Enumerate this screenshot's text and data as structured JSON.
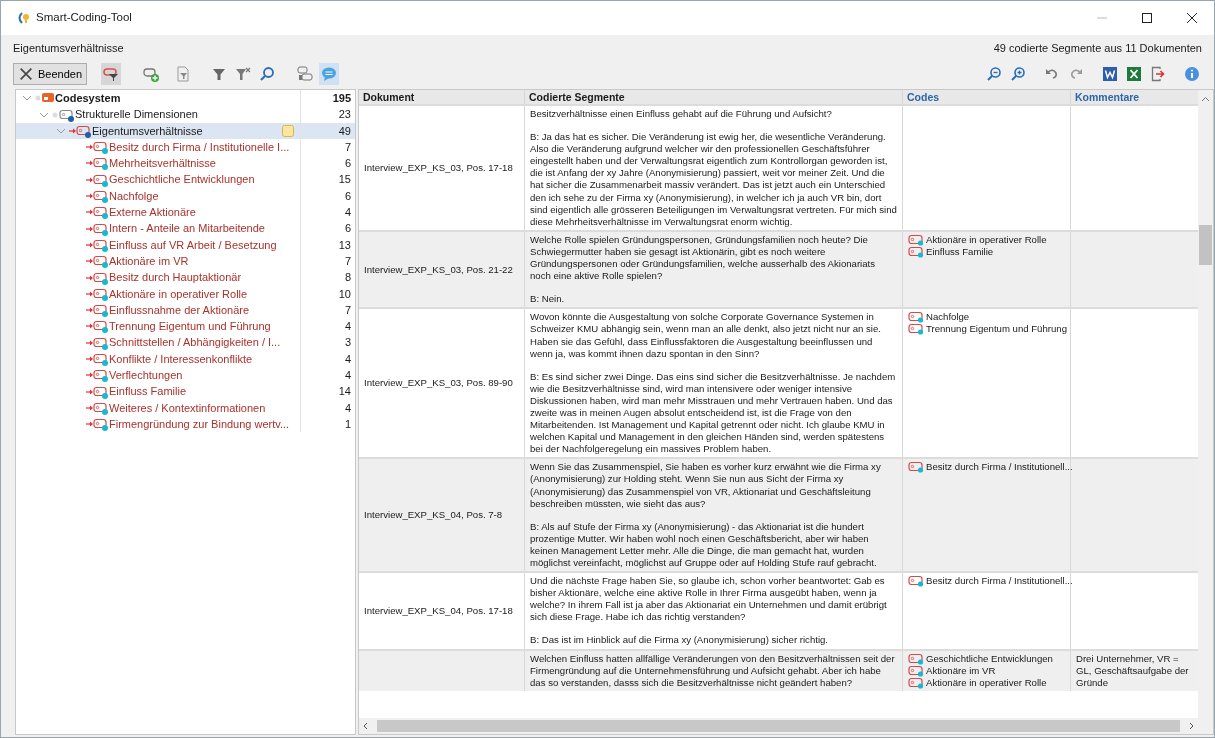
{
  "window": {
    "title": "Smart-Coding-Tool"
  },
  "header": {
    "title": "Eigentumsverhältnisse",
    "summary": "49 codierte Segmente aus 11 Dokumenten"
  },
  "toolbar": {
    "left": [
      {
        "kind": "close",
        "label": "Beenden"
      },
      {
        "kind": "filter-code",
        "on": true
      },
      {
        "kind": "add-code",
        "on": false
      },
      {
        "kind": "doc-filter",
        "on": false
      },
      {
        "kind": "filter",
        "on": false
      },
      {
        "kind": "filter-clear",
        "on": false
      },
      {
        "kind": "search",
        "on": false
      },
      {
        "kind": "toggle-codes",
        "on": false
      },
      {
        "kind": "comment",
        "on": true
      }
    ],
    "right": [
      {
        "kind": "zoom-out"
      },
      {
        "kind": "zoom-in"
      },
      {
        "kind": "undo"
      },
      {
        "kind": "redo"
      },
      {
        "kind": "word"
      },
      {
        "kind": "excel"
      },
      {
        "kind": "export"
      },
      {
        "kind": "info"
      }
    ]
  },
  "codesystem": [
    {
      "kind": "root",
      "label": "Codesystem",
      "count": "195",
      "expanded": true,
      "selected": false,
      "activated": false,
      "memo": false,
      "children": [
        {
          "kind": "code",
          "label": "Strukturelle Dimensionen",
          "count": "23",
          "color": "#1f5fa8",
          "expanded": true,
          "selected": false,
          "activated": false,
          "memo": false,
          "children": [
            {
              "kind": "code",
              "label": "Eigentumsverhältnisse",
              "count": "49",
              "color": "#1f5fa8",
              "expanded": true,
              "selected": true,
              "activated": true,
              "memo": true,
              "children": [
                {
                  "kind": "code",
                  "label": "Besitz durch Firma / Institutionelle I...",
                  "count": "7",
                  "color": "#17b9d2",
                  "selected": false,
                  "activated": true,
                  "memo": false
                },
                {
                  "kind": "code",
                  "label": "Mehrheitsverhältnisse",
                  "count": "6",
                  "color": "#17b9d2",
                  "selected": false,
                  "activated": true,
                  "memo": false
                },
                {
                  "kind": "code",
                  "label": "Geschichtliche Entwicklungen",
                  "count": "15",
                  "color": "#17b9d2",
                  "selected": false,
                  "activated": true,
                  "memo": false
                },
                {
                  "kind": "code",
                  "label": "Nachfolge",
                  "count": "6",
                  "color": "#17b9d2",
                  "selected": false,
                  "activated": true,
                  "memo": false
                },
                {
                  "kind": "code",
                  "label": "Externe Aktionäre",
                  "count": "4",
                  "color": "#17b9d2",
                  "selected": false,
                  "activated": true,
                  "memo": false
                },
                {
                  "kind": "code",
                  "label": "Intern - Anteile an Mitarbeitende",
                  "count": "6",
                  "color": "#17b9d2",
                  "selected": false,
                  "activated": true,
                  "memo": false
                },
                {
                  "kind": "code",
                  "label": "Einfluss auf VR Arbeit / Besetzung",
                  "count": "13",
                  "color": "#17b9d2",
                  "selected": false,
                  "activated": true,
                  "memo": false
                },
                {
                  "kind": "code",
                  "label": "Aktionäre im VR",
                  "count": "7",
                  "color": "#17b9d2",
                  "selected": false,
                  "activated": true,
                  "memo": false
                },
                {
                  "kind": "code",
                  "label": "Besitz durch Hauptaktionär",
                  "count": "8",
                  "color": "#17b9d2",
                  "selected": false,
                  "activated": true,
                  "memo": false
                },
                {
                  "kind": "code",
                  "label": "Aktionäre in operativer Rolle",
                  "count": "10",
                  "color": "#17b9d2",
                  "selected": false,
                  "activated": true,
                  "memo": false
                },
                {
                  "kind": "code",
                  "label": "Einflussnahme der Aktionäre",
                  "count": "7",
                  "color": "#17b9d2",
                  "selected": false,
                  "activated": true,
                  "memo": false
                },
                {
                  "kind": "code",
                  "label": "Trennung Eigentum und Führung",
                  "count": "4",
                  "color": "#17b9d2",
                  "selected": false,
                  "activated": true,
                  "memo": false
                },
                {
                  "kind": "code",
                  "label": "Schnittstellen / Abhängigkeiten / I...",
                  "count": "3",
                  "color": "#17b9d2",
                  "selected": false,
                  "activated": true,
                  "memo": false
                },
                {
                  "kind": "code",
                  "label": "Konflikte / Interessenkonflikte",
                  "count": "4",
                  "color": "#17b9d2",
                  "selected": false,
                  "activated": true,
                  "memo": false
                },
                {
                  "kind": "code",
                  "label": "Verflechtungen",
                  "count": "4",
                  "color": "#17b9d2",
                  "selected": false,
                  "activated": true,
                  "memo": false
                },
                {
                  "kind": "code",
                  "label": "Einfluss Familie",
                  "count": "14",
                  "color": "#17b9d2",
                  "selected": false,
                  "activated": true,
                  "memo": false
                },
                {
                  "kind": "code",
                  "label": "Weiteres / Kontextinformationen",
                  "count": "4",
                  "color": "#17b9d2",
                  "selected": false,
                  "activated": true,
                  "memo": false
                },
                {
                  "kind": "code",
                  "label": "Firmengründung zur Bindung wertv...",
                  "count": "1",
                  "color": "#17b9d2",
                  "selected": false,
                  "activated": true,
                  "memo": false
                }
              ]
            }
          ]
        }
      ]
    }
  ],
  "table": {
    "columns": [
      "Dokument",
      "Codierte Segmente",
      "Codes",
      "Kommentare"
    ],
    "rows": [
      {
        "document": "Interview_EXP_KS_03, Pos. 17-18",
        "segment": [
          "Besitzverhältnisse einen Einfluss gehabt auf die Führung und Aufsicht?",
          "B: Ja das hat es sicher. Die Veränderung ist ewig her, die wesentliche Veränderung. Also die Veränderung aufgrund welcher wir den professionellen Geschäftsführer eingestellt haben und der Verwaltungsrat eigentlich zum Kontrollorgan geworden ist, die ist Anfang der xy Jahre (Anonymisierung) passiert, weit vor meiner Zeit. Und die hat sicher die Zusammenarbeit massiv verändert. Das ist jetzt auch ein Unterschied den ich sehe zu der Firma xy (Anonymisierung), in welcher ich ja auch VR bin, dort sind eigentlich alle grösseren Beteiligungen im Verwaltungsrat vertreten. Für mich sind diese Mehrheitsverhältnisse im Verwaltungsrat enorm wichtig."
        ]
      },
      {
        "document": "Interview_EXP_KS_03, Pos. 21-22",
        "segment": [
          "Welche Rolle spielen Gründungspersonen, Gründungsfamilien noch heute? Die Schwiegermutter haben sie gesagt ist Aktionärin, gibt es noch weitere Gründungspersonen oder Gründungsfamilien, welche ausserhalb des Akionariats noch eine aktive Rolle spielen?",
          "B: Nein."
        ],
        "codes": [
          "Aktionäre in operativer Rolle",
          "Einfluss Familie"
        ]
      },
      {
        "document": "Interview_EXP_KS_03, Pos. 89-90",
        "segment": [
          "Wovon könnte die Ausgestaltung von solche Corporate Governance Systemen in Schweizer KMU abhängig sein, wenn man an alle denkt, also jetzt nicht nur an sie. Haben sie das Gefühl, dass Einflussfaktoren die Ausgestaltung beeinflussen und wenn ja, was kommt ihnen dazu spontan in den Sinn?",
          "B: Es sind sicher zwei Dinge. Das eins sind sicher die Besitzverhältnisse. Je nachdem wie die Besitzverhältnisse sind, wird man intensivere oder weniger intensive Diskussionen haben, wird man mehr Misstrauen und mehr Vertrauen haben. Und das zweite was in meinen Augen absolut entscheidend ist, ist die Frage von den Mitarbeitenden. Ist Management und Kapital getrennt oder nicht. Ich glaube KMU in welchen Kapital und Management in den gleichen Händen sind, werden spätestens bei der Nachfolgeregelung ein massives Problem haben."
        ],
        "codes": [
          "Nachfolge",
          "Trennung Eigentum und Führung"
        ]
      },
      {
        "document": "Interview_EXP_KS_04, Pos. 7-8",
        "segment": [
          "Wenn Sie das Zusammenspiel, Sie haben es vorher kurz erwähnt wie die Firma xy (Anonymisierung) zur Holding steht. Wenn Sie nun aus Sicht der Firma xy (Anonymisierung) das Zusammenspiel von VR, Aktionariat und Geschäftsleitung beschreiben müssten, wie sieht das aus?",
          "B: Als auf Stufe der Firma xy (Anonymisierung) - das Aktionariat ist die hundert prozentige Mutter. Wir haben wohl noch einen Geschäftsbericht, aber wir haben keinen Management Letter mehr. Alle die Dinge, die man gemacht hat, wurden möglichst vereinfacht, möglichst auf Gruppe oder auf Holding Stufe rauf gebracht."
        ],
        "codes": [
          "Besitz durch Firma / Institutionell..."
        ]
      },
      {
        "document": "Interview_EXP_KS_04, Pos. 17-18",
        "segment": [
          "Und die nächste Frage haben Sie, so glaube ich, schon vorher beantwortet: Gab es bisher Aktionäre, welche eine aktive Rolle in Ihrer Firma ausgeübt haben, wenn ja welche? In ihrem Fall ist ja aber das Aktionariat ein Unternehmen und damit erübrigt sich diese Frage. Habe ich das richtig verstanden?",
          "B: Das ist im Hinblick auf die Firma xy (Anonymisierung) sicher richtig."
        ],
        "codes": [
          "Besitz durch Firma / Institutionell..."
        ]
      },
      {
        "segment": [
          "Welchen Einfluss hatten allfällige Veränderungen von den Besitzverhältnissen seit der Firmengründung auf die Unternehmensführung und Aufsicht gehabt. Aber ich habe das so verstanden, dasss sich die Besitzverhältnisse nicht geändert haben?"
        ],
        "codes": [
          "Geschichtliche Entwicklungen",
          "Aktionäre im VR",
          "Aktionäre in operativer Rolle"
        ],
        "comment": "Drei Unternehmer, VR = GL, Geschäftsaufgabe der Gründe"
      }
    ]
  }
}
